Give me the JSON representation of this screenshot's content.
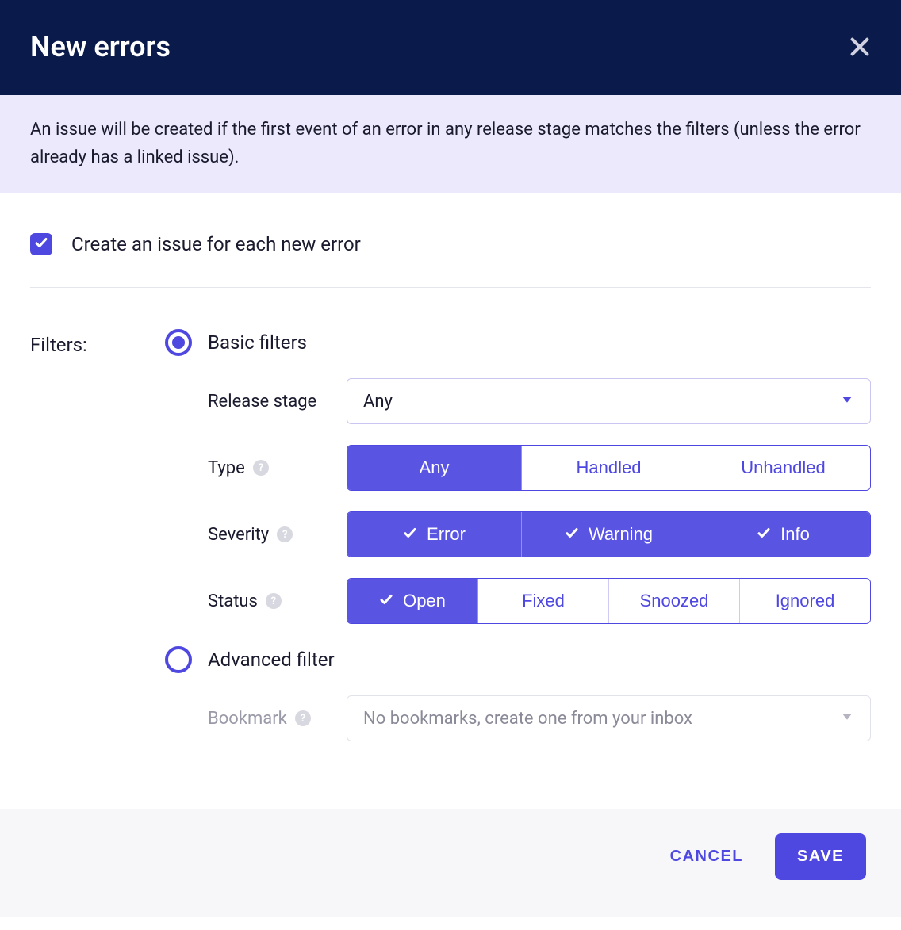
{
  "header": {
    "title": "New errors"
  },
  "banner": {
    "text": "An issue will be created if the first event of an error in any release stage matches the filters (unless the error already has a linked issue)."
  },
  "toggle": {
    "label": "Create an issue for each new error",
    "checked": true
  },
  "filters": {
    "label": "Filters:",
    "basic": {
      "label": "Basic filters",
      "selected": true,
      "release_stage": {
        "label": "Release stage",
        "value": "Any"
      },
      "type": {
        "label": "Type",
        "options": [
          {
            "label": "Any",
            "active": true
          },
          {
            "label": "Handled",
            "active": false
          },
          {
            "label": "Unhandled",
            "active": false
          }
        ]
      },
      "severity": {
        "label": "Severity",
        "options": [
          {
            "label": "Error",
            "active": true
          },
          {
            "label": "Warning",
            "active": true
          },
          {
            "label": "Info",
            "active": true
          }
        ]
      },
      "status": {
        "label": "Status",
        "options": [
          {
            "label": "Open",
            "active": true
          },
          {
            "label": "Fixed",
            "active": false
          },
          {
            "label": "Snoozed",
            "active": false
          },
          {
            "label": "Ignored",
            "active": false
          }
        ]
      }
    },
    "advanced": {
      "label": "Advanced filter",
      "selected": false,
      "bookmark": {
        "label": "Bookmark",
        "placeholder": "No bookmarks, create one from your inbox"
      }
    }
  },
  "footer": {
    "cancel": "CANCEL",
    "save": "SAVE"
  }
}
